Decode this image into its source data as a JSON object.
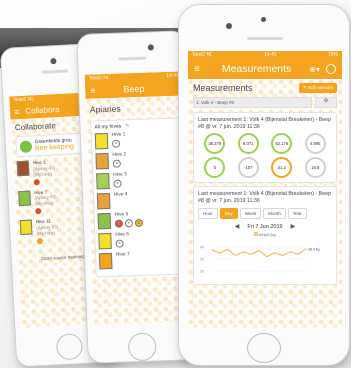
{
  "collab_phone": {
    "status_left": "Telel2 NL",
    "status_time": "14",
    "app_title": "Collabora",
    "page_heading": "Collaborate",
    "group_line1": "Greenfields grou",
    "group_line2": "Bee keeping",
    "hives": [
      {
        "name": "Hive 1",
        "sub": "(Apiary #3)",
        "status": "(My hive)",
        "color": "#a0522d",
        "dot": "#e14d2a"
      },
      {
        "name": "Hive 7",
        "sub": "(Apiary #3)",
        "status": "(My hive)",
        "color": "#8bc34a",
        "dot": "#e14d2a"
      },
      {
        "name": "Hive 11",
        "sub": "(Apiary #3)",
        "status": "(My hive)",
        "color": "#f5e027",
        "dot": "#f4a41e"
      }
    ],
    "footer_text": "Open source beekeepin"
  },
  "beep_phone": {
    "status_left": "Telel2 NL",
    "status_time": "14:41",
    "app_title": "Beep",
    "page_heading": "Apiaries",
    "filter_label": "All my hives",
    "hives": [
      {
        "name": "Hive 1",
        "color": "#f5e027",
        "icons": [
          "x"
        ]
      },
      {
        "name": "Hive 2",
        "color": "#e8a33c",
        "icons": [
          "x"
        ]
      },
      {
        "name": "Hive 3",
        "color": "#a6cf5a",
        "icons": [
          "x"
        ]
      },
      {
        "name": "Hive 4",
        "color": "#e8a33c",
        "icons": []
      },
      {
        "name": "Hive 5",
        "color": "#8bc34a",
        "icons": [
          "!",
          "x",
          "☺"
        ]
      },
      {
        "name": "Hive 6",
        "color": "#f5e027",
        "icons": [
          "x"
        ]
      },
      {
        "name": "Hive 7",
        "color": "#f4a41e",
        "icons": []
      }
    ]
  },
  "measure_phone": {
    "status_left": "Telel2 NL",
    "status_time": "14:41",
    "status_right": "73%",
    "app_title": "Measurements",
    "page_heading": "Measurements",
    "edit_button": "Edit sensors",
    "hive_select": "1: Volk 4 - Beep #8",
    "last_measurement": "Last measurement 1: Volk 4 (Bijenstal Breukelen) - Beep #8 @ vr. 7 jun. 2019 11:36",
    "gauges_top": [
      "38.378",
      "8.071",
      "52.176",
      "4.995"
    ],
    "gauges_bottom": [
      "5",
      "-107",
      "31.2",
      "18.8"
    ],
    "last_measurement_2": "Last measurement 1: Volk 4 (Bijenstal Breukelen) - Beep #8 @ vr. 7 jun. 2019 11:36",
    "tabs": [
      "Hour",
      "Day",
      "Week",
      "Month",
      "Year"
    ],
    "active_tab": "Day",
    "date_label": "Fri 7 Jun 2019",
    "chart_legend": "Weight (kg)",
    "chart_value_label": "38.4 kg",
    "chart_y_ticks": [
      "40",
      "30",
      "20"
    ],
    "colors": {
      "accent": "#f4a41e",
      "green": "#9ad34f"
    }
  },
  "chart_data": {
    "type": "line",
    "ylabel": "Weight (kg)",
    "ylim": [
      20,
      45
    ],
    "series": [
      {
        "name": "Weight (kg)",
        "values": [
          37.5,
          35,
          38,
          33,
          36,
          34,
          37,
          32,
          35,
          33,
          36,
          34,
          38.4
        ]
      }
    ]
  }
}
